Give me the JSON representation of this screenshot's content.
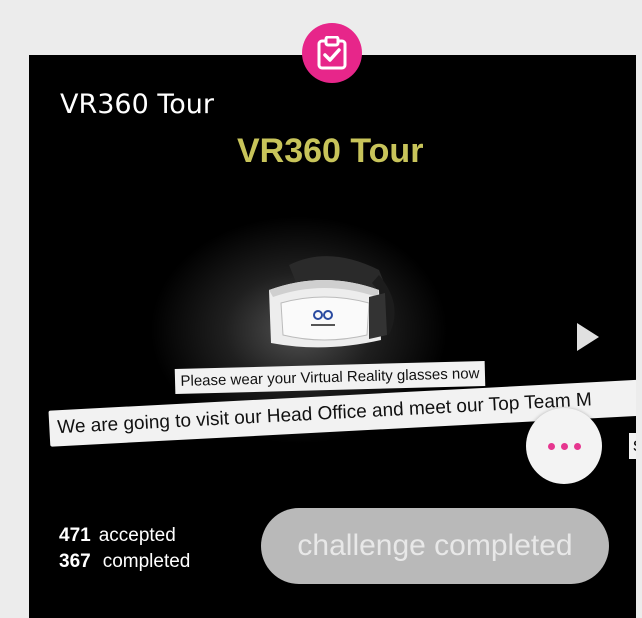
{
  "card": {
    "title": "VR360 Tour",
    "video": {
      "title": "VR360 Tour",
      "banner_line1": "Please wear your Virtual Reality glasses now",
      "banner_line2": "We are going to visit our Head Office and meet our Top Team M",
      "banner_line2_tail": "s"
    },
    "stats": {
      "accepted_count": "471",
      "accepted_label": "accepted",
      "completed_count": "367",
      "completed_label": "completed"
    },
    "action_button": "challenge completed"
  },
  "icons": {
    "badge": "clipboard-check-icon",
    "play": "play-icon",
    "more": "more-dots-icon"
  },
  "colors": {
    "accent": "#e7268a",
    "title_yellow": "#c8c45a",
    "button_gray": "#b9b9b9"
  }
}
